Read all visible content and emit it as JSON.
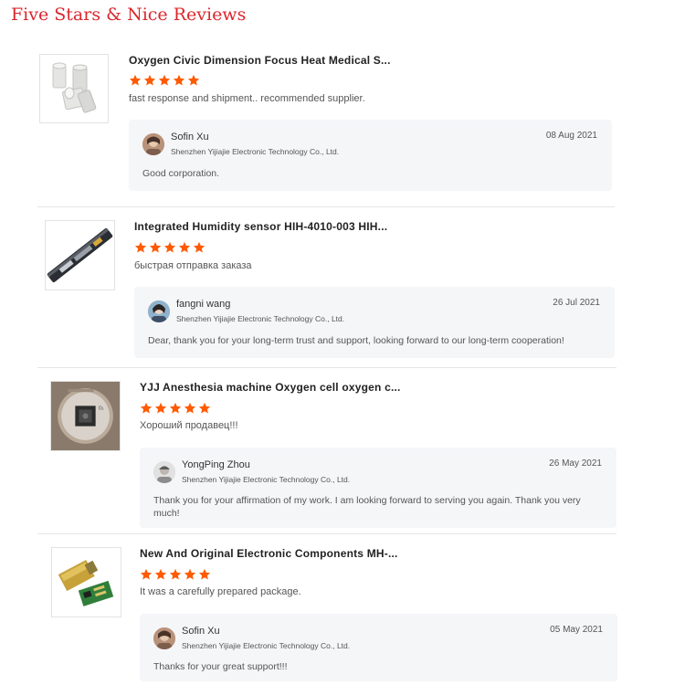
{
  "page": {
    "title": "Five Stars & Nice Reviews",
    "accent_color": "#d9272e",
    "star_color": "#ff5a00"
  },
  "reviews": [
    {
      "product_title": "Oxygen Civic Dimension Focus Heat Medical S...",
      "rating": 5,
      "comment": "fast response and shipment.. recommended supplier.",
      "thumbnail": "white-cylindrical-sensors",
      "reply": {
        "name": "Sofin Xu",
        "company": "Shenzhen Yijiajie Electronic Technology Co., Ltd.",
        "date": "08 Aug 2021",
        "text": "Good corporation."
      }
    },
    {
      "product_title": "Integrated Humidity sensor HIH-4010-003 HIH...",
      "rating": 5,
      "comment": "быстрая отправка заказа",
      "thumbnail": "sensor-in-tube",
      "reply": {
        "name": "fangni wang",
        "company": "Shenzhen Yijiajie Electronic Technology Co., Ltd.",
        "date": "26 Jul 2021",
        "text": "Dear, thank you for your long-term trust and support, looking forward to our long-term cooperation!"
      }
    },
    {
      "product_title": "YJJ Anesthesia machine Oxygen cell oxygen c...",
      "rating": 5,
      "comment": "Хороший продавец!!!",
      "thumbnail": "oxygen-cell",
      "reply": {
        "name": "YongPing Zhou",
        "company": "Shenzhen Yijiajie Electronic Technology Co., Ltd.",
        "date": "26 May 2021",
        "text_line1": "Thank you for your affirmation of my work. I am looking forward to serving you again. Thank you very",
        "text_line2": "much!"
      }
    },
    {
      "product_title": "New And Original Electronic Components MH-...",
      "rating": 5,
      "comment": "It was a carefully prepared package.",
      "thumbnail": "gas-sensor-module",
      "reply": {
        "name": "Sofin Xu",
        "company": "Shenzhen Yijiajie Electronic Technology Co., Ltd.",
        "date": "05 May 2021",
        "text": "Thanks for your great support!!!"
      }
    }
  ]
}
